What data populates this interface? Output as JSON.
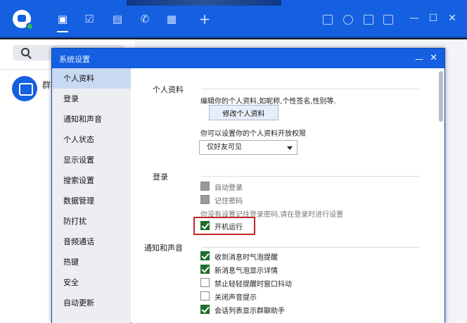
{
  "topbar": {
    "nav": [
      "chat-icon",
      "calendar-icon",
      "contacts-icon",
      "phone-icon",
      "apps-icon",
      "add-icon"
    ],
    "tools": [
      "save-icon",
      "history-icon",
      "folder-icon",
      "cube-icon"
    ],
    "window_controls": {
      "minimize": "—",
      "maximize": "☐",
      "close": "✕"
    }
  },
  "left_panel": {
    "group_name": "群"
  },
  "dialog": {
    "title": "系统设置",
    "minimize_glyph": "—",
    "close_glyph": "✕",
    "nav_items": [
      "个人资料",
      "登录",
      "通知和声音",
      "个人状态",
      "显示设置",
      "搜索设置",
      "数据管理",
      "防打扰",
      "音频通话",
      "热键",
      "安全",
      "自动更新"
    ],
    "selected_nav": 0,
    "sections": {
      "profile": {
        "title": "个人资料",
        "desc": "编辑你的个人资料,如昵称,个性签名,性别等.",
        "edit_button": "修改个人资料",
        "perm_desc": "你可以设置你的个人资料开放权限",
        "perm_value": "仅好友可见"
      },
      "login": {
        "title": "登录",
        "auto_login": "自动登录",
        "remember_pw": "记住密码",
        "hint": "你没有设置记住登录密码,请在登录时进行设置",
        "startup": "开机运行"
      },
      "notify": {
        "title": "通知和声音",
        "items": [
          {
            "label": "收到消息时气泡提醒",
            "checked": true
          },
          {
            "label": "新消息气泡显示详情",
            "checked": true
          },
          {
            "label": "禁止轻轻提醒时窗口抖动",
            "checked": false
          },
          {
            "label": "关闭声音提示",
            "checked": false
          },
          {
            "label": "会话列表显示群聊助手",
            "checked": true
          }
        ]
      }
    }
  }
}
